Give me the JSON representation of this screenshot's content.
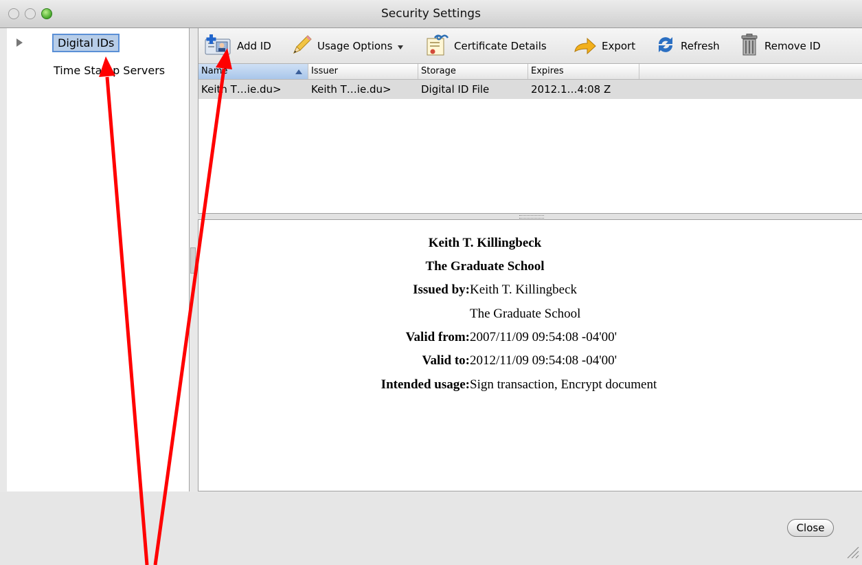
{
  "window": {
    "title": "Security Settings"
  },
  "sidebar": {
    "items": [
      {
        "label": "Digital IDs"
      },
      {
        "label": "Time Stamp Servers"
      }
    ]
  },
  "toolbar": {
    "add_id": "Add ID",
    "usage_options": "Usage Options",
    "certificate_details": "Certificate Details",
    "export": "Export",
    "refresh": "Refresh",
    "remove_id": "Remove ID"
  },
  "table": {
    "columns": [
      "Name",
      "Issuer",
      "Storage",
      "Expires"
    ],
    "rows": [
      {
        "name": "Keith T…ie.du>",
        "issuer": "Keith T…ie.du>",
        "storage": "Digital ID File",
        "expires": "2012.1…4:08 Z"
      }
    ]
  },
  "details": {
    "name": "Keith T. Killingbeck",
    "org": "The Graduate School",
    "issued_by_label": "Issued by:",
    "issued_by_name": "Keith T. Killingbeck",
    "issued_by_org": "The Graduate School",
    "valid_from_label": "Valid from:",
    "valid_from": "2007/11/09 09:54:08 -04'00'",
    "valid_to_label": "Valid to:",
    "valid_to": "2012/11/09 09:54:08 -04'00'",
    "usage_label": "Intended usage:",
    "usage": "Sign transaction, Encrypt document"
  },
  "footer": {
    "close": "Close"
  },
  "colors": {
    "annotation_arrow": "#ff0000",
    "selection": "#b7cde8",
    "zoom_button": "#46a62a"
  }
}
